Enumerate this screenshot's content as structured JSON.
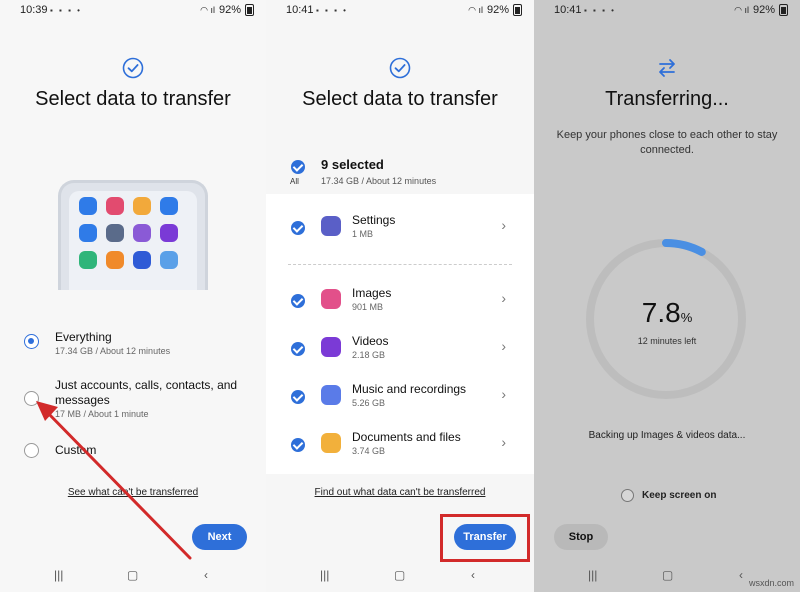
{
  "screen1": {
    "time": "10:39",
    "battery": "92%",
    "title": "Select data to transfer",
    "check_icon": "check-circle-icon",
    "options": [
      {
        "label": "Everything",
        "sub": "17.34 GB / About 12 minutes",
        "selected": true
      },
      {
        "label": "Just accounts, calls, contacts, and messages",
        "sub": "17 MB / About 1 minute",
        "selected": false
      },
      {
        "label": "Custom",
        "sub": "",
        "selected": false
      }
    ],
    "link": "See what can't be transferred",
    "next": "Next",
    "app_colors": [
      "#2f7be8",
      "#e24b6f",
      "#f2a93b",
      "#2f7be8",
      "#2f7be8",
      "#5a6b8a",
      "#8a5ad6",
      "#7a3ad6",
      "#2fb57a",
      "#f08a2a",
      "#2f5bd6",
      "#5aa0e8"
    ]
  },
  "screen2": {
    "time": "10:41",
    "battery": "92%",
    "title": "Select data to transfer",
    "selected_count": "9 selected",
    "selected_sub": "17.34 GB / About 12 minutes",
    "all_label": "All",
    "items": [
      {
        "label": "Settings",
        "sub": "1 MB",
        "icon": "gear-icon",
        "color": "#5a5fc7"
      },
      {
        "label": "Images",
        "sub": "901 MB",
        "icon": "image-icon",
        "color": "#e2508a"
      },
      {
        "label": "Videos",
        "sub": "2.18 GB",
        "icon": "play-icon",
        "color": "#7b3ad6"
      },
      {
        "label": "Music and recordings",
        "sub": "5.26 GB",
        "icon": "music-icon",
        "color": "#5a7be8"
      },
      {
        "label": "Documents and files",
        "sub": "3.74 GB",
        "icon": "document-icon",
        "color": "#f2b03b"
      }
    ],
    "link": "Find out what data can't be transferred",
    "transfer": "Transfer"
  },
  "screen3": {
    "time": "10:41",
    "battery": "92%",
    "title": "Transferring...",
    "message": "Keep your phones close to each other to stay connected.",
    "percent_value": "7.8",
    "percent_sign": "%",
    "progress_fraction": 0.078,
    "time_left": "12 minutes left",
    "status": "Backing up Images & videos data...",
    "keep_screen": "Keep screen on",
    "stop": "Stop"
  },
  "watermark": "wsxdn.com",
  "accent": "#2e6fd9",
  "highlight": "#d22a2a"
}
